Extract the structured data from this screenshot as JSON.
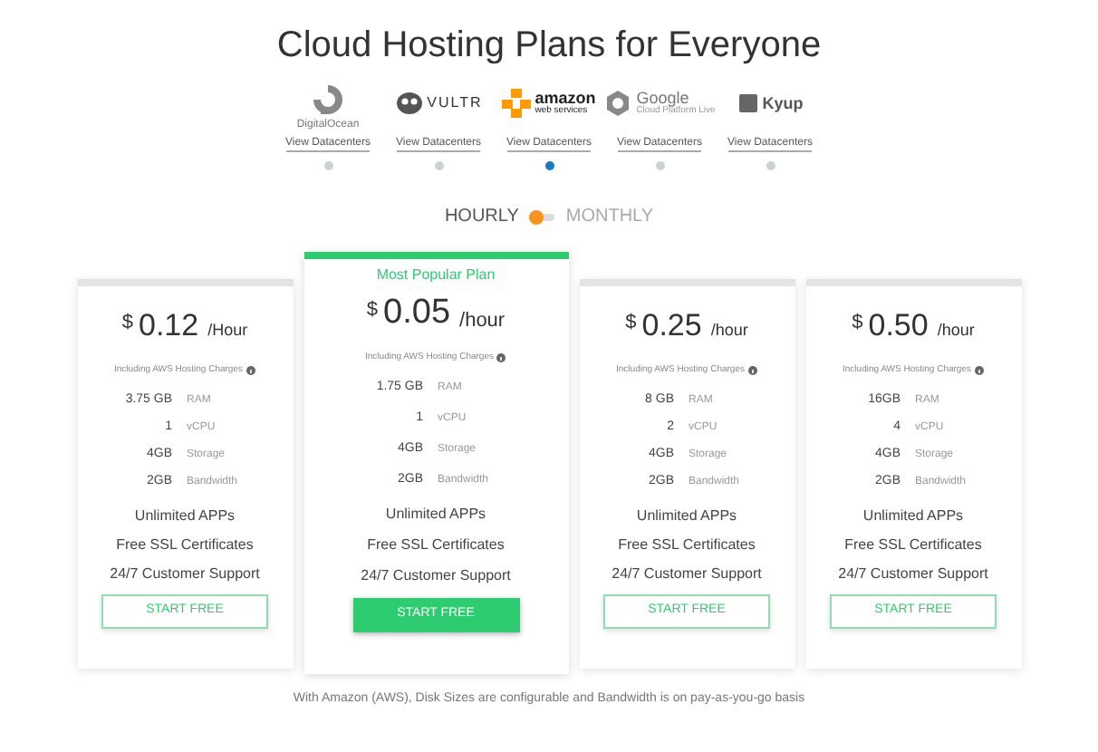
{
  "heading": "Cloud Hosting Plans for Everyone",
  "providers": [
    {
      "kind": "digitalocean",
      "logo_text": "DigitalOcean",
      "link": "View Datacenters",
      "selected": false
    },
    {
      "kind": "vultr",
      "logo_text": "VULTR",
      "link": "View Datacenters",
      "selected": false
    },
    {
      "kind": "amazon",
      "logo_text": "amazon",
      "logo_subtext": "web services",
      "link": "View Datacenters",
      "selected": true
    },
    {
      "kind": "google",
      "logo_text": "Google",
      "logo_subtext": "Cloud Platform Live",
      "link": "View Datacenters",
      "selected": false
    },
    {
      "kind": "kyup",
      "logo_text": "Kyup",
      "link": "View Datacenters",
      "selected": false
    }
  ],
  "billing": [
    {
      "label": "HOURLY",
      "selected": true
    },
    {
      "label": "MONTHLY",
      "selected": false
    }
  ],
  "plans": [
    {
      "featured": false,
      "currency": "$",
      "price": "0.12",
      "unit": "/Hour",
      "note": "Including AWS Hosting Charges",
      "specs": [
        {
          "value": "3.75 GB",
          "label": "RAM"
        },
        {
          "value": "1",
          "label": "vCPU"
        },
        {
          "value": "4GB",
          "label": "Storage"
        },
        {
          "value": "2GB",
          "label": "Bandwidth"
        }
      ],
      "features": [
        "Unlimited APPs",
        "Free SSL Certificates",
        "24/7 Customer Support"
      ],
      "button": "START FREE"
    },
    {
      "featured": true,
      "badge": "Most Popular Plan",
      "currency": "$",
      "price": "0.05",
      "unit": "/hour",
      "note": "Including AWS Hosting Charges",
      "specs": [
        {
          "value": "1.75 GB",
          "label": "RAM"
        },
        {
          "value": "1",
          "label": "vCPU"
        },
        {
          "value": "4GB",
          "label": "Storage"
        },
        {
          "value": "2GB",
          "label": "Bandwidth"
        }
      ],
      "features": [
        "Unlimited APPs",
        "Free SSL Certificates",
        "24/7 Customer Support"
      ],
      "button": "START FREE"
    },
    {
      "featured": false,
      "currency": "$",
      "price": "0.25",
      "unit": "/hour",
      "note": "Including AWS Hosting Charges",
      "specs": [
        {
          "value": "8 GB",
          "label": "RAM"
        },
        {
          "value": "2",
          "label": "vCPU"
        },
        {
          "value": "4GB",
          "label": "Storage"
        },
        {
          "value": "2GB",
          "label": "Bandwidth"
        }
      ],
      "features": [
        "Unlimited APPs",
        "Free SSL Certificates",
        "24/7 Customer Support"
      ],
      "button": "START FREE"
    },
    {
      "featured": false,
      "currency": "$",
      "price": "0.50",
      "unit": "/hour",
      "note": "Including AWS Hosting Charges",
      "specs": [
        {
          "value": "16GB",
          "label": "RAM"
        },
        {
          "value": "4",
          "label": "vCPU"
        },
        {
          "value": "4GB",
          "label": "Storage"
        },
        {
          "value": "2GB",
          "label": "Bandwidth"
        }
      ],
      "features": [
        "Unlimited APPs",
        "Free SSL Certificates",
        "24/7 Customer Support"
      ],
      "button": "START FREE"
    }
  ],
  "footnote": "With Amazon (AWS), Disk Sizes are configurable and Bandwidth is on pay-as-you-go basis"
}
